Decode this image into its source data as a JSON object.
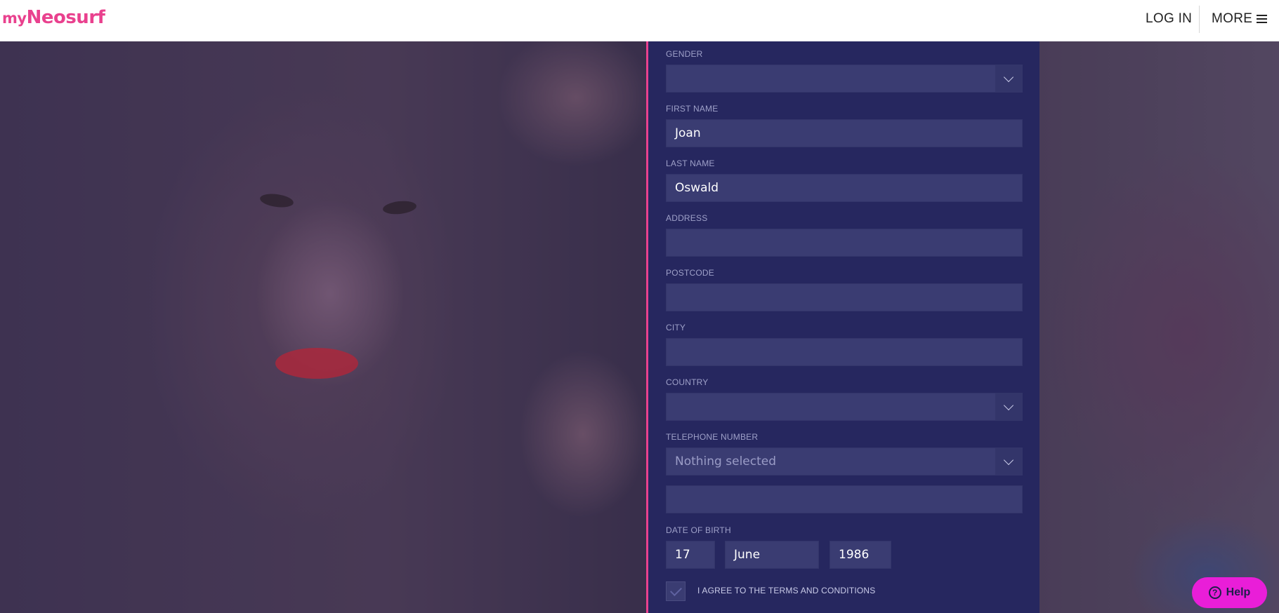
{
  "header": {
    "logo_prefix": "my",
    "logo_name": "Neosurf",
    "login_label": "LOG IN",
    "more_label": "MORE"
  },
  "form": {
    "gender_label": "GENDER",
    "gender_value": "",
    "first_name_label": "FIRST NAME",
    "first_name_value": "Joan",
    "last_name_label": "LAST NAME",
    "last_name_value": "Oswald",
    "address_label": "ADDRESS",
    "address_value": "",
    "postcode_label": "POSTCODE",
    "postcode_value": "",
    "city_label": "CITY",
    "city_value": "",
    "country_label": "COUNTRY",
    "country_value": "",
    "telephone_label": "TELEPHONE NUMBER",
    "telephone_code_value": "Nothing selected",
    "telephone_number_value": "",
    "dob_label": "DATE OF BIRTH",
    "dob_day": "17",
    "dob_month": "June",
    "dob_year": "1986",
    "terms_label": "I AGREE TO THE TERMS AND CONDITIONS"
  },
  "help": {
    "label": "Help",
    "icon": "?"
  },
  "colors": {
    "brand_pink": "#e9418e",
    "panel_bg": "#26275f",
    "field_bg": "#3a3c72",
    "help_bg": "#e91ed8"
  },
  "icons": {
    "menu": "hamburger-icon",
    "dropdown": "chevron-down-icon",
    "checkbox": "checkmark-icon",
    "help": "question-circle-icon"
  }
}
